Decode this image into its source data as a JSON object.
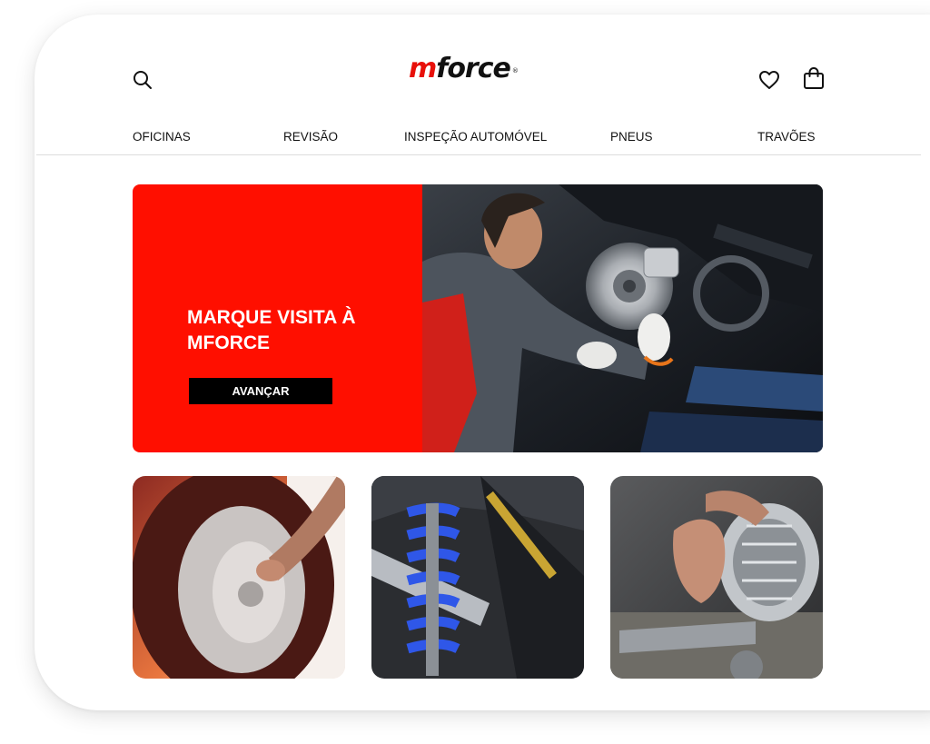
{
  "brand": {
    "logo_prefix": "m",
    "logo_rest": "force",
    "registered": "®",
    "accent": "#e8100a"
  },
  "header": {
    "search_icon": "search-icon",
    "favorites_icon": "heart-icon",
    "cart_icon": "shopping-bag-icon"
  },
  "nav": {
    "items": [
      {
        "label": "OFICINAS"
      },
      {
        "label": "REVISÃO"
      },
      {
        "label": "INSPEÇÃO AUTOMÓVEL"
      },
      {
        "label": "PNEUS"
      },
      {
        "label": "TRAVÕES"
      }
    ]
  },
  "hero": {
    "title": "MARQUE VISITA À MFORCE",
    "button_label": "AVANÇAR",
    "background": "#ff0f00",
    "photo": "mechanic-inspecting-brake-disc"
  },
  "thumbnails": [
    {
      "photo": "tyre-wheel"
    },
    {
      "photo": "blue-suspension-coil"
    },
    {
      "photo": "alternator-repair"
    }
  ]
}
